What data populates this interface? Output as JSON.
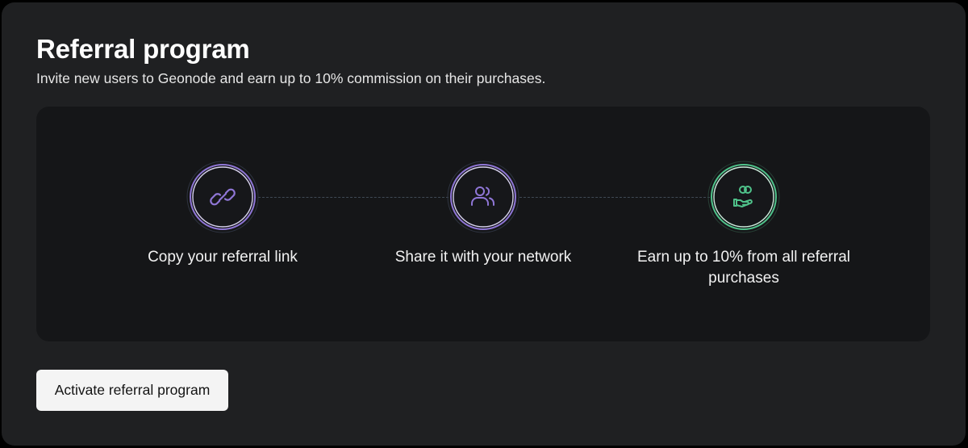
{
  "header": {
    "title": "Referral program",
    "subtitle": "Invite new users to Geonode and earn up to 10% commission on their purchases."
  },
  "steps": [
    {
      "label": "Copy your referral link",
      "icon": "link-icon",
      "accent": "#8f76d6"
    },
    {
      "label": "Share it with your network",
      "icon": "users-icon",
      "accent": "#8f76d6"
    },
    {
      "label": "Earn up to 10% from all referral purchases",
      "icon": "money-hand-icon",
      "accent": "#4fc28a"
    }
  ],
  "actions": {
    "activate_label": "Activate referral program"
  },
  "colors": {
    "background": "#000000",
    "card": "#1f2022",
    "panel": "#151618",
    "purple_accent": "#8f76d6",
    "green_accent": "#4fc28a",
    "button_bg": "#f4f4f4"
  }
}
